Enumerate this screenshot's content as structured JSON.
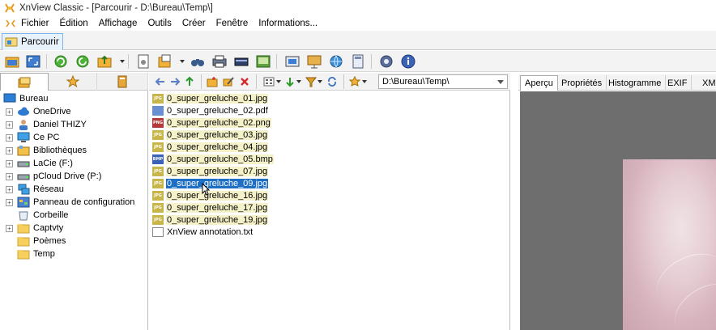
{
  "window": {
    "title": "XnView Classic - [Parcourir - D:\\Bureau\\Temp\\]"
  },
  "menubar": {
    "items": [
      "Fichier",
      "Édition",
      "Affichage",
      "Outils",
      "Créer",
      "Fenêtre",
      "Informations..."
    ]
  },
  "tabs": [
    {
      "label": "Parcourir",
      "icon": "browser-icon",
      "active": true
    }
  ],
  "toolbar": {
    "buttons": [
      "open-folder-icon",
      "fullscreen-icon",
      "refresh-icon",
      "rotate-icon",
      "up-folder-icon",
      "document-icon",
      "copy-to-icon",
      "binoculars-icon",
      "print-icon",
      "scanner-icon",
      "slideshow-icon",
      "capture-icon",
      "presentation-icon",
      "globe-web-icon",
      "calculator-icon",
      "settings-gear-icon",
      "info-icon"
    ]
  },
  "left_panel": {
    "tabs": [
      "folders-icon",
      "favorites-star-icon",
      "categories-icon"
    ],
    "tree": [
      {
        "label": "Bureau",
        "icon": "desktop-icon",
        "level": 0,
        "expander": ""
      },
      {
        "label": "OneDrive",
        "icon": "cloud-icon",
        "level": 1,
        "expander": "+"
      },
      {
        "label": "Daniel THIZY",
        "icon": "user-icon",
        "level": 1,
        "expander": "+"
      },
      {
        "label": "Ce PC",
        "icon": "computer-icon",
        "level": 1,
        "expander": "+"
      },
      {
        "label": "Bibliothèques",
        "icon": "library-icon",
        "level": 1,
        "expander": "+"
      },
      {
        "label": "LaCie (F:)",
        "icon": "drive-icon",
        "level": 1,
        "expander": "+"
      },
      {
        "label": "pCloud Drive (P:)",
        "icon": "drive-icon",
        "level": 1,
        "expander": "+"
      },
      {
        "label": "Réseau",
        "icon": "network-icon",
        "level": 1,
        "expander": "+"
      },
      {
        "label": "Panneau de configuration",
        "icon": "control-panel-icon",
        "level": 1,
        "expander": "+"
      },
      {
        "label": "Corbeille",
        "icon": "recycle-bin-icon",
        "level": 1,
        "expander": ""
      },
      {
        "label": "Captvty",
        "icon": "folder-icon",
        "level": 1,
        "expander": "+"
      },
      {
        "label": "Poèmes",
        "icon": "folder-icon",
        "level": 1,
        "expander": ""
      },
      {
        "label": "Temp",
        "icon": "folder-icon",
        "level": 1,
        "expander": ""
      }
    ]
  },
  "file_panel": {
    "path": "D:\\Bureau\\Temp\\",
    "toolbar_icons": [
      "back-arrow-icon",
      "forward-arrow-icon",
      "up-arrow-icon",
      "new-folder-icon",
      "rename-icon",
      "delete-icon",
      "view-mode-icon",
      "sort-icon",
      "filter-icon",
      "refresh-icon",
      "favorite-star-icon"
    ],
    "files": [
      {
        "name": "0_super_greluche_01.jpg",
        "type": "jpg",
        "state": "highlight"
      },
      {
        "name": "0_super_greluche_02.pdf",
        "type": "pdf",
        "state": ""
      },
      {
        "name": "0_super_greluche_02.png",
        "type": "png",
        "state": "highlight"
      },
      {
        "name": "0_super_greluche_03.jpg",
        "type": "jpg",
        "state": "highlight"
      },
      {
        "name": "0_super_greluche_04.jpg",
        "type": "jpg",
        "state": "highlight"
      },
      {
        "name": "0_super_greluche_05.bmp",
        "type": "bmp",
        "state": "highlight"
      },
      {
        "name": "0_super_greluche_07.jpg",
        "type": "jpg",
        "state": "highlight"
      },
      {
        "name": "0_super_greluche_09.jpg",
        "type": "jpg",
        "state": "selected"
      },
      {
        "name": "0_super_greluche_16.jpg",
        "type": "jpg",
        "state": "highlight"
      },
      {
        "name": "0_super_greluche_17.jpg",
        "type": "jpg",
        "state": "highlight"
      },
      {
        "name": "0_super_greluche_19.jpg",
        "type": "jpg",
        "state": "highlight"
      },
      {
        "name": "XnView annotation.txt",
        "type": "txt",
        "state": ""
      }
    ]
  },
  "preview_panel": {
    "tabs": [
      "Aperçu",
      "Propriétés",
      "Histogramme",
      "EXIF",
      "XM"
    ]
  },
  "colors": {
    "selection": "#1e6fc4",
    "highlight": "#f5f1c8",
    "preview_background": "#6e6e6e"
  }
}
